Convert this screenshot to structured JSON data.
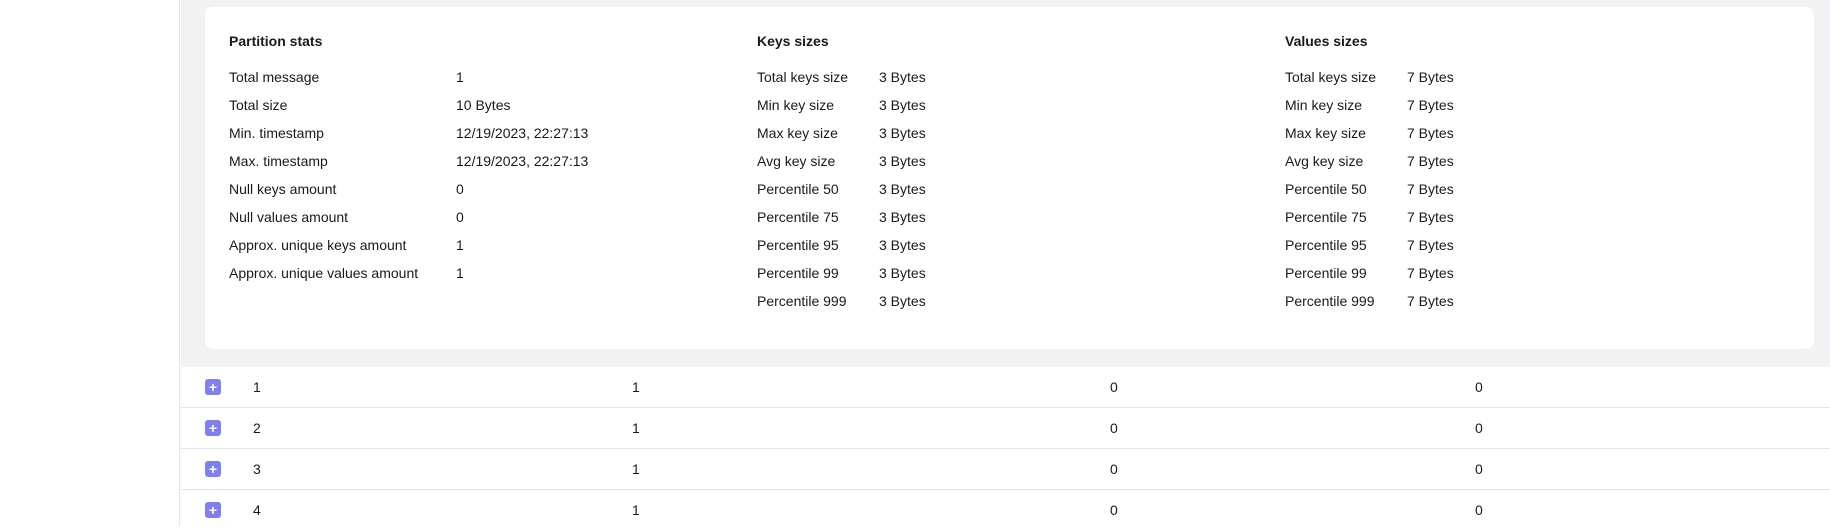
{
  "partition_stats": {
    "title": "Partition stats",
    "rows": [
      {
        "label": "Total message",
        "value": "1"
      },
      {
        "label": "Total size",
        "value": "10 Bytes"
      },
      {
        "label": "Min. timestamp",
        "value": "12/19/2023, 22:27:13"
      },
      {
        "label": "Max. timestamp",
        "value": "12/19/2023, 22:27:13"
      },
      {
        "label": "Null keys amount",
        "value": "0"
      },
      {
        "label": "Null values amount",
        "value": "0"
      },
      {
        "label": "Approx. unique keys amount",
        "value": "1"
      },
      {
        "label": "Approx. unique values amount",
        "value": "1"
      }
    ]
  },
  "keys_sizes": {
    "title": "Keys sizes",
    "rows": [
      {
        "label": "Total keys size",
        "value": "3 Bytes"
      },
      {
        "label": "Min key size",
        "value": "3 Bytes"
      },
      {
        "label": "Max key size",
        "value": "3 Bytes"
      },
      {
        "label": "Avg key size",
        "value": "3 Bytes"
      },
      {
        "label": "Percentile 50",
        "value": "3 Bytes"
      },
      {
        "label": "Percentile 75",
        "value": "3 Bytes"
      },
      {
        "label": "Percentile 95",
        "value": "3 Bytes"
      },
      {
        "label": "Percentile 99",
        "value": "3 Bytes"
      },
      {
        "label": "Percentile 999",
        "value": "3 Bytes"
      }
    ]
  },
  "values_sizes": {
    "title": "Values sizes",
    "rows": [
      {
        "label": "Total keys size",
        "value": "7 Bytes"
      },
      {
        "label": "Min key size",
        "value": "7 Bytes"
      },
      {
        "label": "Max key size",
        "value": "7 Bytes"
      },
      {
        "label": "Avg key size",
        "value": "7 Bytes"
      },
      {
        "label": "Percentile 50",
        "value": "7 Bytes"
      },
      {
        "label": "Percentile 75",
        "value": "7 Bytes"
      },
      {
        "label": "Percentile 95",
        "value": "7 Bytes"
      },
      {
        "label": "Percentile 99",
        "value": "7 Bytes"
      },
      {
        "label": "Percentile 999",
        "value": "7 Bytes"
      }
    ]
  },
  "partition_rows": [
    {
      "expand_icon": "+",
      "cells": [
        "1",
        "1",
        "0",
        "0"
      ]
    },
    {
      "expand_icon": "+",
      "cells": [
        "2",
        "1",
        "0",
        "0"
      ]
    },
    {
      "expand_icon": "+",
      "cells": [
        "3",
        "1",
        "0",
        "0"
      ]
    },
    {
      "expand_icon": "+",
      "cells": [
        "4",
        "1",
        "0",
        "0"
      ]
    }
  ],
  "colors": {
    "accent": "#7f7ff0",
    "panel_background": "#f1f2f3",
    "card_background": "#ffffff"
  }
}
